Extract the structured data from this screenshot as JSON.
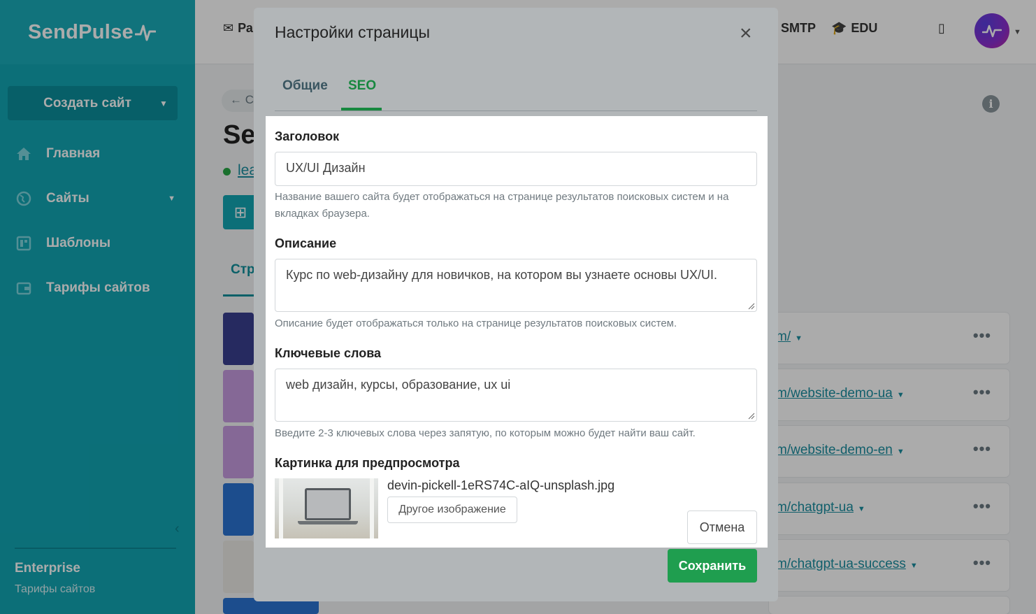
{
  "app": {
    "logo_text": "SendPulse"
  },
  "sidebar": {
    "create_label": "Создать сайт",
    "items": [
      {
        "label": "Главная",
        "icon": "home-icon"
      },
      {
        "label": "Сайты",
        "icon": "globe-icon",
        "has_caret": true
      },
      {
        "label": "Шаблоны",
        "icon": "template-icon"
      },
      {
        "label": "Тарифы сайтов",
        "icon": "wallet-icon"
      }
    ],
    "plan_name": "Enterprise",
    "plan_link": "Тарифы сайтов"
  },
  "topbar": {
    "item_partial": "Ра",
    "smtp": "SMTP",
    "edu": "EDU"
  },
  "background": {
    "back_partial": "← С",
    "title_partial": "Se",
    "link_partial": "lea",
    "tab_partial": "Стр",
    "rows": [
      {
        "url": "m/"
      },
      {
        "url": "m/website-demo-ua"
      },
      {
        "url": "m/website-demo-en"
      },
      {
        "url": "m/chatgpt-ua"
      },
      {
        "url": "m/chatgpt-ua-success"
      }
    ]
  },
  "modal": {
    "title": "Настройки страницы",
    "tabs": {
      "general": "Общие",
      "seo": "SEO"
    },
    "fields": {
      "title_label": "Заголовок",
      "title_value": "UX/UI Дизайн",
      "title_help": "Название вашего сайта будет отображаться на странице результатов поисковых систем и на вкладках браузера.",
      "description_label": "Описание",
      "description_value": "Курс по web-дизайну для новичков, на котором вы узнаете основы UX/UI.",
      "description_help": "Описание будет отображаться только на странице результатов поисковых систем.",
      "keywords_label": "Ключевые слова",
      "keywords_value": "web дизайн, курсы, образование, ux ui",
      "keywords_help": "Введите 2-3 ключевых слова через запятую, по которым можно будет найти ваш сайт.",
      "preview_label": "Картинка для предпросмотра",
      "preview_filename": "devin-pickell-1eRS74C-aIQ-unsplash.jpg",
      "preview_button": "Другое изображение"
    },
    "buttons": {
      "cancel": "Отмена",
      "save": "Сохранить"
    }
  },
  "colors": {
    "sidebar": "#12a6b4",
    "accent_green": "#1f9e4f",
    "link": "#1a8ea0"
  }
}
